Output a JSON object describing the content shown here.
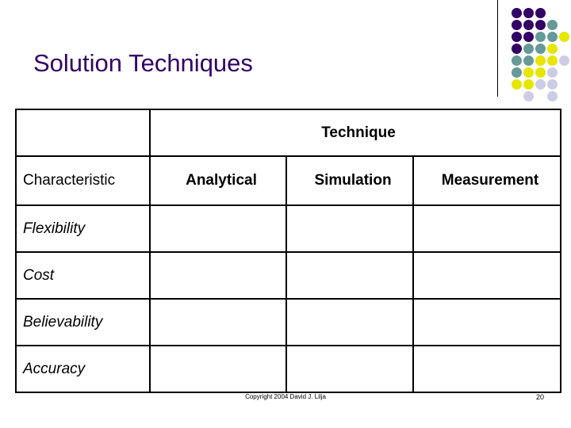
{
  "slide": {
    "title": "Solution Techniques",
    "title_color": "#330066",
    "background_color": "#FFFFFF"
  },
  "decoration": {
    "name": "dot-grid",
    "columns": 5,
    "rows": 8,
    "cell_size": 15,
    "dot_diameter": 13,
    "palette": {
      "purple": "#330066",
      "teal": "#669999",
      "yellow": "#E6E600",
      "lavender": "#CCCCE6",
      "empty": null
    },
    "matrix": [
      [
        "purple",
        "purple",
        "purple",
        "empty",
        "empty"
      ],
      [
        "purple",
        "purple",
        "purple",
        "teal",
        "empty"
      ],
      [
        "purple",
        "purple",
        "teal",
        "teal",
        "yellow"
      ],
      [
        "purple",
        "teal",
        "teal",
        "yellow",
        "empty"
      ],
      [
        "teal",
        "teal",
        "yellow",
        "yellow",
        "lavender"
      ],
      [
        "teal",
        "yellow",
        "yellow",
        "lavender",
        "empty"
      ],
      [
        "yellow",
        "yellow",
        "lavender",
        "lavender",
        "empty"
      ],
      [
        "empty",
        "lavender",
        "empty",
        "lavender",
        "empty"
      ]
    ]
  },
  "table": {
    "group_header": "Technique",
    "columns": [
      {
        "key": "characteristic",
        "label": "Characteristic",
        "bold": false
      },
      {
        "key": "analytical",
        "label": "Analytical",
        "bold": true
      },
      {
        "key": "simulation",
        "label": "Simulation",
        "bold": true
      },
      {
        "key": "measurement",
        "label": "Measurement",
        "bold": true
      }
    ],
    "rows": [
      {
        "label": "Flexibility",
        "analytical": "",
        "simulation": "",
        "measurement": ""
      },
      {
        "label": "Cost",
        "analytical": "",
        "simulation": "",
        "measurement": ""
      },
      {
        "label": "Believability",
        "analytical": "",
        "simulation": "",
        "measurement": ""
      },
      {
        "label": "Accuracy",
        "analytical": "",
        "simulation": "",
        "measurement": ""
      }
    ]
  },
  "footer": {
    "copyright": "Copyright 2004 David J. Lilja",
    "page_number": "20"
  }
}
